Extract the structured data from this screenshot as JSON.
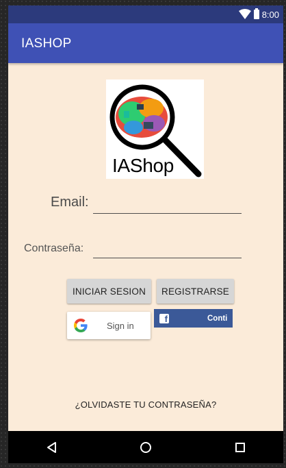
{
  "status_bar": {
    "time": "8:00",
    "icons": [
      "wifi-icon",
      "battery-icon"
    ]
  },
  "app_bar": {
    "title": "IASHOP"
  },
  "logo": {
    "text": "IAShop",
    "icon": "magnifier-brain-icon"
  },
  "form": {
    "email_label": "Email:",
    "email_value": "",
    "password_label": "Contraseña:",
    "password_value": ""
  },
  "buttons": {
    "login": "INICIAR SESION",
    "register": "REGISTRARSE",
    "google": "Sign in",
    "facebook": "Conti"
  },
  "links": {
    "forgot_password": "¿OLVIDASTE TU CONTRASEÑA?"
  },
  "nav_bar": {
    "icons": [
      "back-icon",
      "home-icon",
      "recents-icon"
    ]
  },
  "colors": {
    "app_bar": "#3f51b5",
    "status_bar": "#2c3a7c",
    "background": "#fbebd9",
    "facebook": "#3b5998"
  }
}
